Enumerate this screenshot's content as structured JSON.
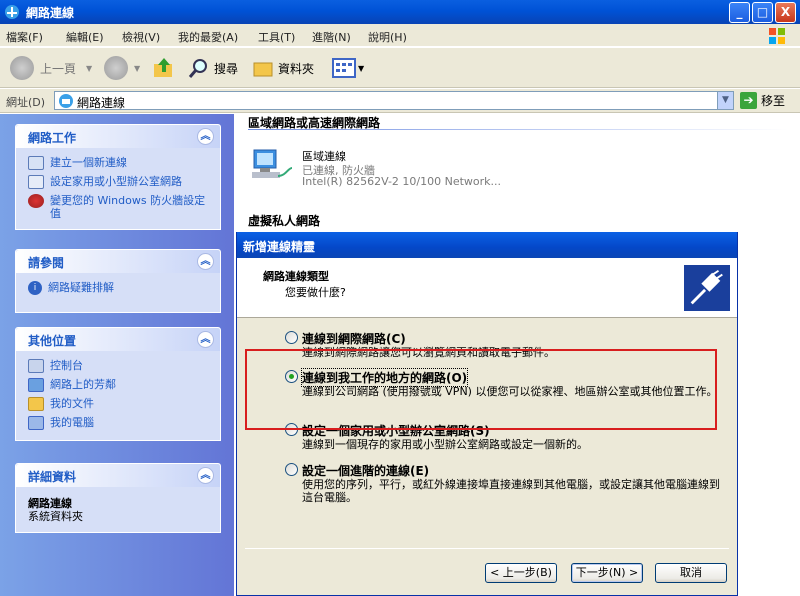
{
  "window": {
    "title": "網路連線",
    "min": "_",
    "max": "□",
    "close": "X"
  },
  "menu": [
    "檔案(F)",
    "編輯(E)",
    "檢視(V)",
    "我的最愛(A)",
    "工具(T)",
    "進階(N)",
    "說明(H)"
  ],
  "toolbar": {
    "back": "上一頁",
    "search": "搜尋",
    "folders": "資料夾"
  },
  "address": {
    "label": "網址(D)",
    "value": "網路連線",
    "go": "移至"
  },
  "left_panels": {
    "tasks": {
      "title": "網路工作",
      "items": [
        "建立一個新連線",
        "設定家用或小型辦公室網路",
        "變更您的 Windows 防火牆設定值"
      ]
    },
    "see_also": {
      "title": "請參閱",
      "items": [
        "網路疑難排解"
      ]
    },
    "other_places": {
      "title": "其他位置",
      "items": [
        "控制台",
        "網路上的芳鄰",
        "我的文件",
        "我的電腦"
      ]
    },
    "details": {
      "title": "詳細資料",
      "name": "網路連線",
      "type": "系統資料夾"
    }
  },
  "content": {
    "section1": "區域網路或高速網際網路",
    "lan": {
      "name": "區域連線",
      "status": "已連線, 防火牆",
      "device": "Intel(R) 82562V-2 10/100 Network..."
    },
    "section2": "虛擬私人網路"
  },
  "wizard": {
    "title": "新增連線精靈",
    "heading": "網路連線類型",
    "subheading": "您要做什麼?",
    "options": [
      {
        "label": "連線到網際網路(C)",
        "desc": "連線到網際網路讓您可以瀏覽網頁和讀取電子郵件。",
        "selected": false
      },
      {
        "label": "連線到我工作的地方的網路(O)",
        "desc": "連線到公司網路 (使用撥號或 VPN) 以便您可以從家裡、地區辦公室或其他位置工作。",
        "selected": true
      },
      {
        "label": "設定一個家用或小型辦公室網路(S)",
        "desc": "連線到一個現存的家用或小型辦公室網路或設定一個新的。",
        "selected": false
      },
      {
        "label": "設定一個進階的連線(E)",
        "desc": "使用您的序列，平行，或紅外線連接埠直接連線到其他電腦，或設定讓其他電腦連線到這台電腦。",
        "selected": false
      }
    ],
    "buttons": {
      "back": "< 上一步(B)",
      "next": "下一步(N) >",
      "cancel": "取消"
    }
  }
}
